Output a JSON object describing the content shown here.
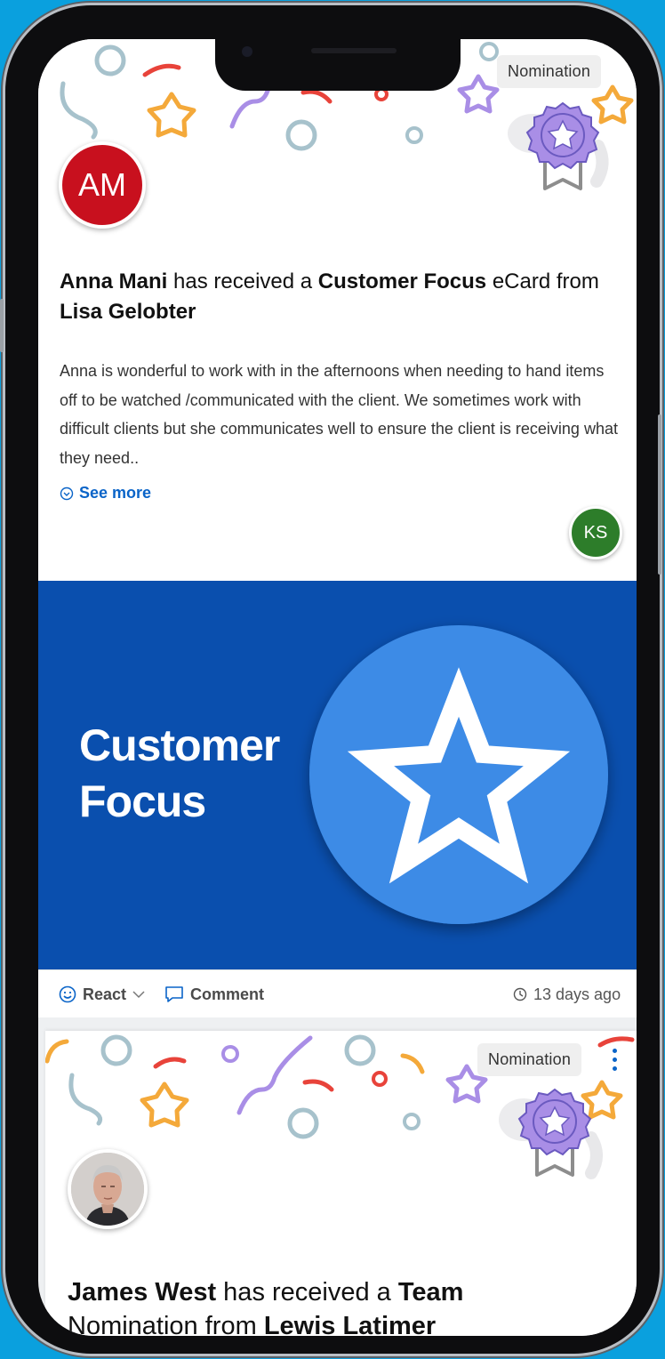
{
  "feed": {
    "cards": [
      {
        "badge": "Nomination",
        "recipient_initials": "AM",
        "recipient_name": "Anna Mani",
        "text_received": " has received a ",
        "award_name": "Customer Focus",
        "text_ecard_from": " eCard from ",
        "sender_name": "Lisa Gelobter",
        "message": "Anna is wonderful to work with in the afternoons when needing to hand items off to be watched /communicated with the client. We sometimes work with difficult clients but she communicates well to ensure the client is receiving what they need..",
        "see_more_label": "See more",
        "participant_initials": "KS",
        "ecard": {
          "line1": "Customer",
          "line2": "Focus"
        },
        "react_label": "React",
        "comment_label": "Comment",
        "timestamp": "13 days ago"
      },
      {
        "badge": "Nomination",
        "recipient_name": "James West",
        "text_received": " has received a ",
        "award_name": "Team",
        "text_line2": "Nomination from ",
        "sender_name": "Lewis Latimer"
      }
    ]
  },
  "colors": {
    "background": "#0aa0de",
    "avatar_am": "#c8101e",
    "avatar_ks": "#2d7d2a",
    "ecard_bg": "#0a4fae",
    "ecard_circle": "#3d8be6",
    "link": "#0a64c8",
    "badge_purple": "#a98ee6"
  }
}
